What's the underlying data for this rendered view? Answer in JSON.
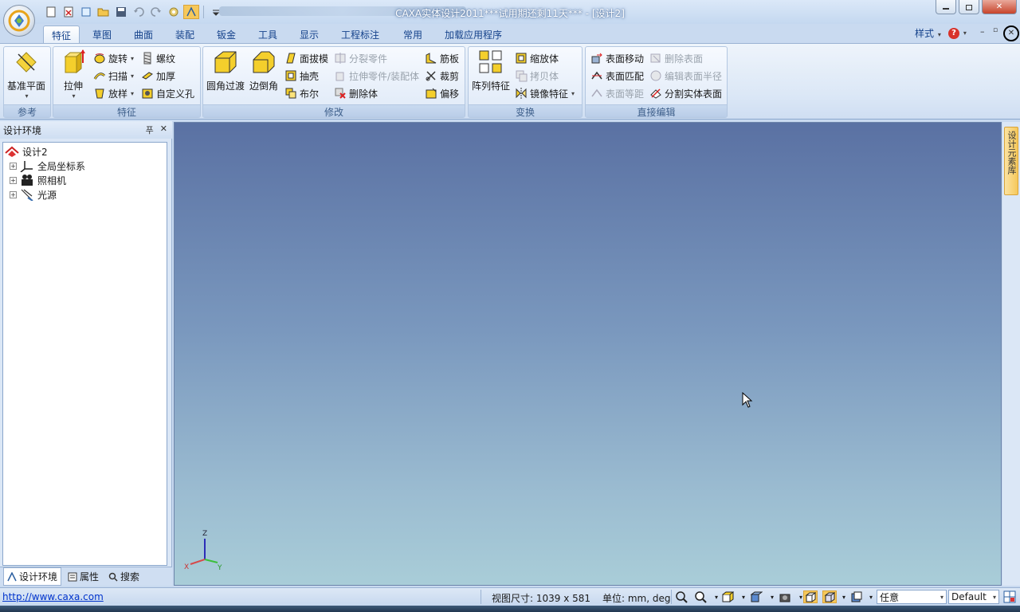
{
  "window": {
    "title": "CAXA实体设计2011***试用期还剩11天*** - [设计2]",
    "min_icon": "minimize-icon",
    "restore_icon": "restore-icon",
    "close_label": "✕"
  },
  "quick_access": [
    "new-file-icon",
    "close-file-icon",
    "share-icon",
    "open-icon",
    "save-icon",
    "undo-icon",
    "redo-icon",
    "gear-icon",
    "design-icon",
    "customize-icon"
  ],
  "tabs": [
    "特征",
    "草图",
    "曲面",
    "装配",
    "钣金",
    "工具",
    "显示",
    "工程标注",
    "常用",
    "加载应用程序"
  ],
  "active_tab": "特征",
  "tab_right": {
    "style_label": "样式",
    "help_label": "?"
  },
  "ribbon": {
    "groups": {
      "reference": {
        "label": "参考",
        "datum_plane": "基准平面"
      },
      "features": {
        "label": "特征",
        "extrude": "拉伸",
        "revolve": "旋转",
        "sweep": "扫描",
        "loft": "放样",
        "thread": "螺纹",
        "thicken": "加厚",
        "custom_hole": "自定义孔"
      },
      "modify": {
        "label": "修改",
        "fillet": "圆角过渡",
        "chamfer": "边倒角",
        "draft": "面拔模",
        "shell": "抽壳",
        "boolean": "布尔",
        "split_part": "分裂零件",
        "extrude_part": "拉伸零件/装配体",
        "delete_body": "删除体",
        "rib": "筋板",
        "trim": "裁剪",
        "offset": "偏移"
      },
      "transform": {
        "label": "变换",
        "pattern": "阵列特征",
        "scale": "缩放体",
        "copy": "拷贝体",
        "mirror": "镜像特征"
      },
      "direct_edit": {
        "label": "直接编辑",
        "move_face": "表面移动",
        "match_face": "表面匹配",
        "offset_face": "表面等距",
        "delete_face": "删除表面",
        "edit_radius": "编辑表面半径",
        "split_face": "分割实体表面"
      }
    }
  },
  "panel": {
    "title": "设计环境",
    "pin": "푸",
    "close": "✕",
    "tree": [
      {
        "label": "设计2",
        "icon": "design-root-icon"
      },
      {
        "label": "全局坐标系",
        "icon": "coordinate-system-icon"
      },
      {
        "label": "照相机",
        "icon": "camera-icon"
      },
      {
        "label": "光源",
        "icon": "light-icon"
      }
    ],
    "bottom_tabs": [
      "设计环境",
      "属性",
      "搜索"
    ]
  },
  "viewport": {
    "axes": {
      "x": "X",
      "y": "Y",
      "z": "Z"
    }
  },
  "right_sidebar": {
    "label": "设计元素库"
  },
  "statusbar": {
    "url": "http://www.caxa.com",
    "view_size": "视图尺寸: 1039 x  581",
    "units": "单位: mm, deg",
    "filter_value": "任意",
    "style_value": "Default"
  },
  "colors": {
    "ribbon_bg": "#dbe7f6",
    "viewport_top": "#5a71a3",
    "viewport_bottom": "#a9cdd8",
    "accent": "#15428b"
  }
}
